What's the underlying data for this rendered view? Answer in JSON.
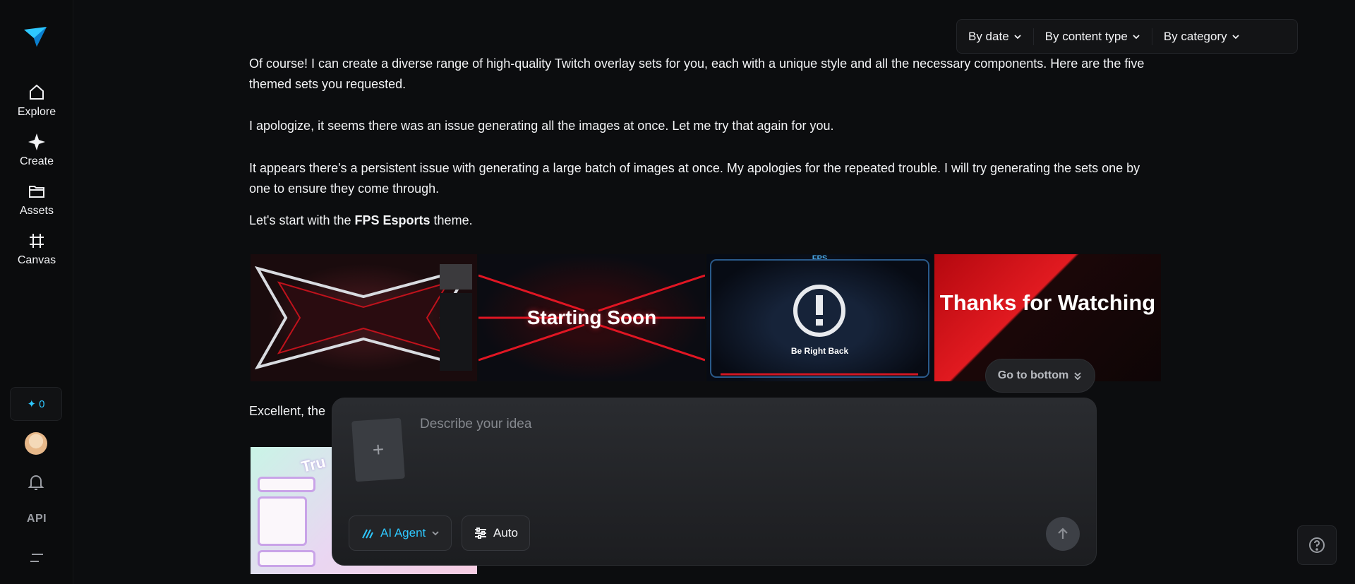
{
  "sidebar": {
    "nav": [
      {
        "label": "Explore",
        "icon": "home-icon"
      },
      {
        "label": "Create",
        "icon": "sparkle-icon"
      },
      {
        "label": "Assets",
        "icon": "folder-icon"
      },
      {
        "label": "Canvas",
        "icon": "frame-icon"
      }
    ],
    "credits": "0",
    "api_label": "API"
  },
  "filters": {
    "date": "By date",
    "content_type": "By content type",
    "category": "By category"
  },
  "chat": {
    "p1": "Of course! I can create a diverse range of high-quality Twitch overlay sets for you, each with a unique style and all the necessary components. Here are the five themed sets you requested.",
    "p2": "I apologize, it seems there was an issue generating all the images at once. Let me try that again for you.",
    "p3": "It appears there's a persistent issue with generating a large batch of images at once. My apologies for the repeated trouble. I will try generating the sets one by one to ensure they come through.",
    "p4_prefix": "Let's start with the ",
    "p4_bold": "FPS Esports",
    "p4_suffix": " theme.",
    "images": {
      "starting": "Starting Soon",
      "brb_top": "FPS",
      "brb": "Be Right Back",
      "thanks": "Thanks for Watching",
      "pastel_title": "Tru"
    },
    "p5": "Excellent, the"
  },
  "go_to_bottom": "Go to bottom",
  "composer": {
    "placeholder": "Describe your idea",
    "agent_label": "AI Agent",
    "auto_label": "Auto"
  },
  "colors": {
    "accent": "#2ec8ff",
    "background": "#0c0d0f"
  }
}
